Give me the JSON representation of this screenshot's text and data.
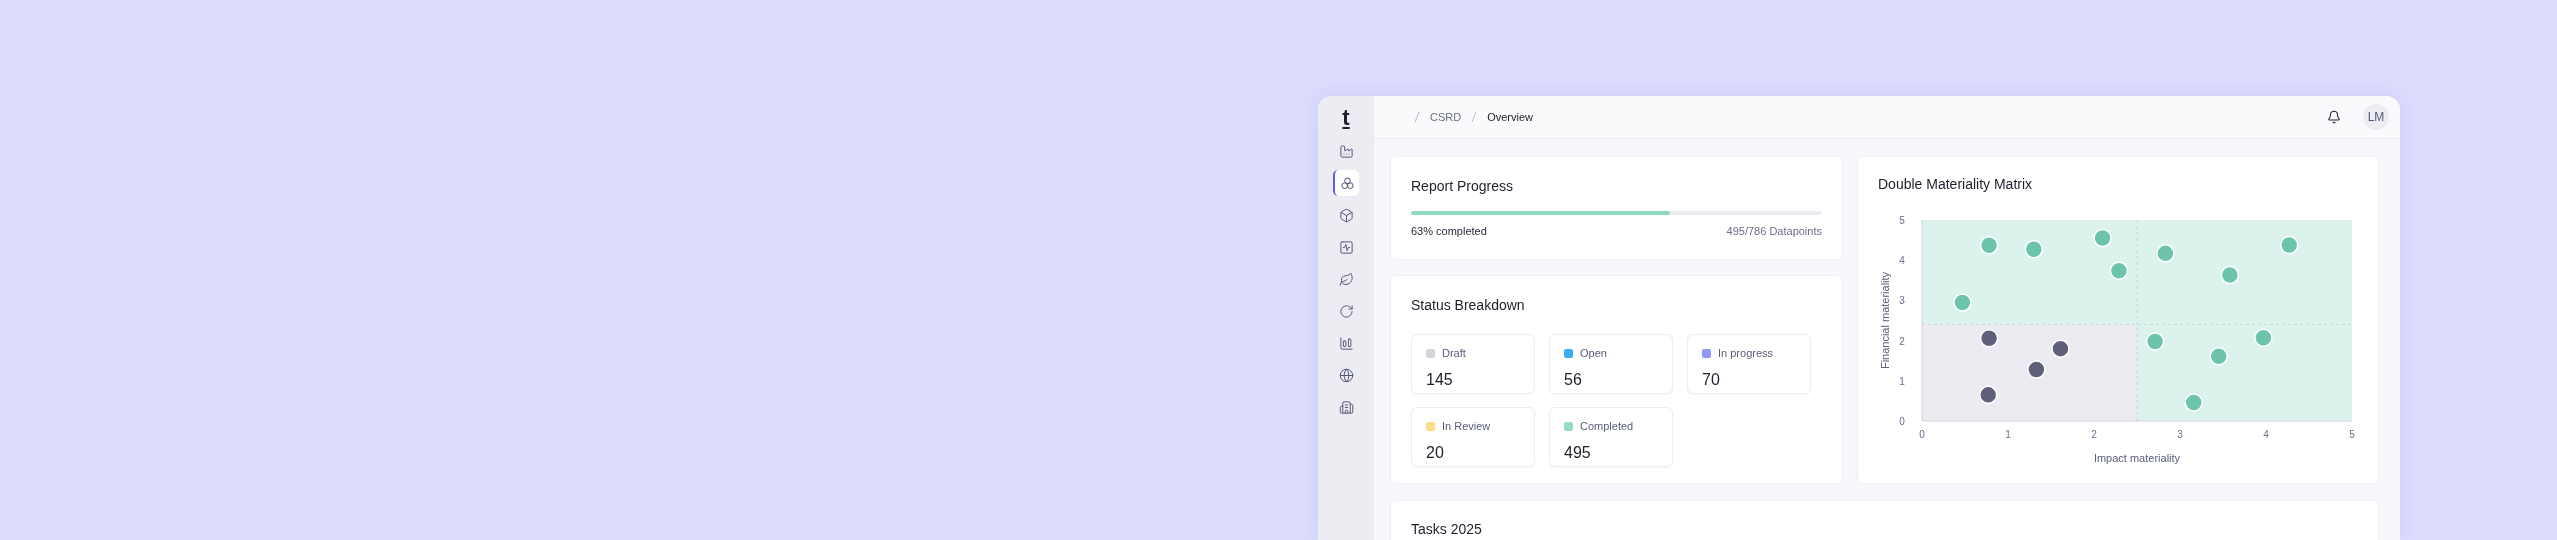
{
  "sidebar": {
    "logo": "t",
    "items": [
      {
        "selected": false
      },
      {
        "selected": true
      },
      {
        "selected": false
      },
      {
        "selected": false
      },
      {
        "selected": false
      },
      {
        "selected": false
      },
      {
        "selected": false
      },
      {
        "selected": false
      },
      {
        "selected": false
      }
    ]
  },
  "breadcrumb": [
    {
      "label": "CSRD",
      "current": false
    },
    {
      "label": "Overview",
      "current": true
    }
  ],
  "header": {
    "avatar": "LM"
  },
  "report_progress": {
    "title": "Report Progress",
    "level": 0.63,
    "completed": "63% completed",
    "count": "495/786 Datapoints"
  },
  "status_breakdown": {
    "title": "Status Breakdown",
    "items": [
      {
        "label": "Draft",
        "value": "145",
        "color": "#d4d4de"
      },
      {
        "label": "Open",
        "value": "56",
        "color": "#38aef5"
      },
      {
        "label": "In progress",
        "value": "70",
        "color": "#9198f5"
      },
      {
        "label": "In Review",
        "value": "20",
        "color": "#fbdc8a"
      },
      {
        "label": "Completed",
        "value": "495",
        "color": "#97dcc6"
      }
    ]
  },
  "matrix": {
    "title": "Double Materiality Matrix",
    "chart_data": {
      "type": "scatter",
      "xlabel": "Impact materiality",
      "ylabel": "Financial materiality",
      "ref_lines": [
        {
          "axis": "x",
          "value": 2.5
        },
        {
          "axis": "y",
          "value": 2.4
        }
      ],
      "xlim": [
        0,
        5
      ],
      "ylim": [
        0,
        5
      ],
      "xticks": [
        0,
        1,
        2,
        3,
        4,
        5
      ],
      "yticks": [
        0,
        1,
        2,
        3,
        4,
        5
      ],
      "series": [
        {
          "color": "#6cc4ad",
          "x": [
            0.78,
            1.3,
            2.1,
            2.29,
            2.83,
            3.58,
            4.27,
            0.47,
            2.71,
            3.45,
            3.97,
            3.16
          ],
          "values": [
            4.37,
            4.27,
            4.55,
            3.74,
            4.17,
            3.63,
            4.38,
            2.95,
            1.98,
            1.61,
            2.07,
            0.46
          ]
        },
        {
          "color": "#5e6179",
          "x": [
            0.78,
            1.61,
            1.33,
            0.77
          ],
          "values": [
            2.06,
            1.8,
            1.28,
            0.65
          ]
        }
      ]
    }
  },
  "tasks": {
    "title": "Tasks 2025"
  }
}
